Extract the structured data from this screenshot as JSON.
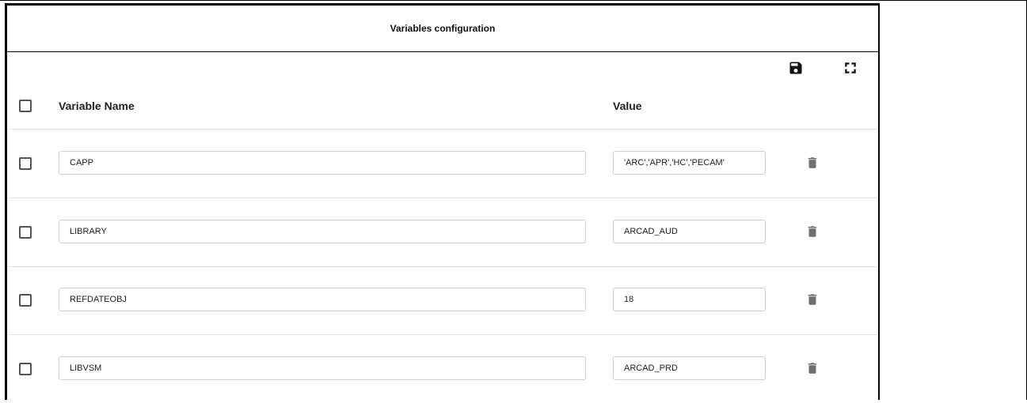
{
  "dialog": {
    "title": "Variables configuration"
  },
  "toolbar": {
    "save_icon": "save-icon",
    "fullscreen_icon": "fullscreen-icon"
  },
  "table": {
    "columns": [
      "Variable Name",
      "Value"
    ],
    "rows": [
      {
        "name": "CAPP",
        "value": "'ARC','APR','HC','PECAM'"
      },
      {
        "name": "LIBRARY",
        "value": "ARCAD_AUD"
      },
      {
        "name": "REFDATEOBJ",
        "value": "18"
      },
      {
        "name": "LIBVSM",
        "value": "ARCAD_PRD"
      }
    ],
    "row_action_icon": "trash-icon"
  },
  "colors": {
    "border": "#000000",
    "icon": "#6f6f6f",
    "divider": "#e4e4e4"
  }
}
